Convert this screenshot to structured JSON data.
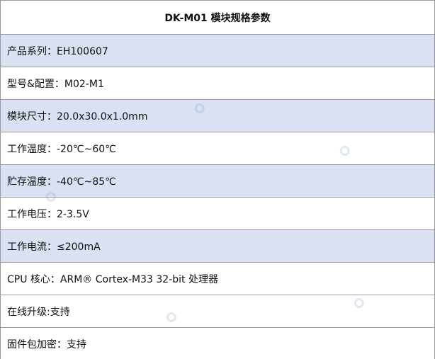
{
  "title": "DK-M01 模块规格参数",
  "rows": [
    {
      "text": "产品系列：EH100607"
    },
    {
      "text": "型号&配置：M02-M1"
    },
    {
      "text": "模块尺寸：20.0x30.0x1.0mm"
    },
    {
      "text": "工作温度：-20℃~60℃"
    },
    {
      "text": "贮存温度：-40℃~85℃"
    },
    {
      "text": "工作电压：2-3.5V"
    },
    {
      "text": "工作电流：≤200mA"
    },
    {
      "text": "CPU 核心：ARM® Cortex-M33 32-bit 处理器"
    },
    {
      "text": "在线升级:支持"
    },
    {
      "text": "固件包加密：支持"
    }
  ],
  "colors": {
    "shaded_row": "#d9e1f2",
    "plain_row": "#ffffff",
    "border": "#9a9a9a"
  }
}
